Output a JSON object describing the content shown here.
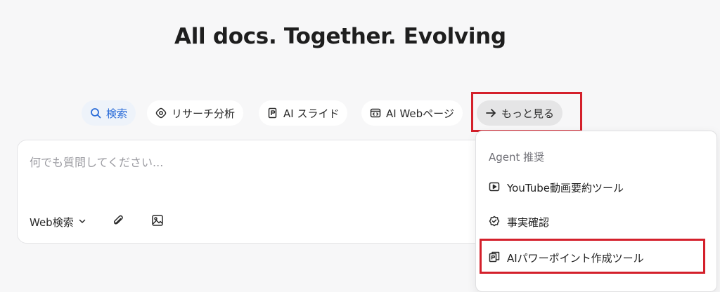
{
  "hero": {
    "title": "All docs. Together. Evolving"
  },
  "chips": [
    {
      "label": "検索",
      "icon": "search-icon"
    },
    {
      "label": "リサーチ分析",
      "icon": "research-icon"
    },
    {
      "label": "AI スライド",
      "icon": "slide-icon"
    },
    {
      "label": "AI Webページ",
      "icon": "webpage-icon"
    },
    {
      "label": "もっと見る",
      "icon": "arrow-right-icon"
    }
  ],
  "colors": {
    "accent": "#2b6cd8",
    "annotation": "#d4202b",
    "background": "#f7f7f8"
  },
  "input": {
    "placeholder": "何でも質問してください...",
    "value": ""
  },
  "toolbar": {
    "web_search_label": "Web検索",
    "attach_icon": "paperclip-icon",
    "image_icon": "image-icon"
  },
  "dropdown": {
    "header": "Agent 推奨",
    "items": [
      {
        "label": "YouTube動画要約ツール",
        "icon": "play-icon"
      },
      {
        "label": "事実確認",
        "icon": "check-badge-icon"
      },
      {
        "label": "AIパワーポイント作成ツール",
        "icon": "document-icon"
      }
    ]
  }
}
